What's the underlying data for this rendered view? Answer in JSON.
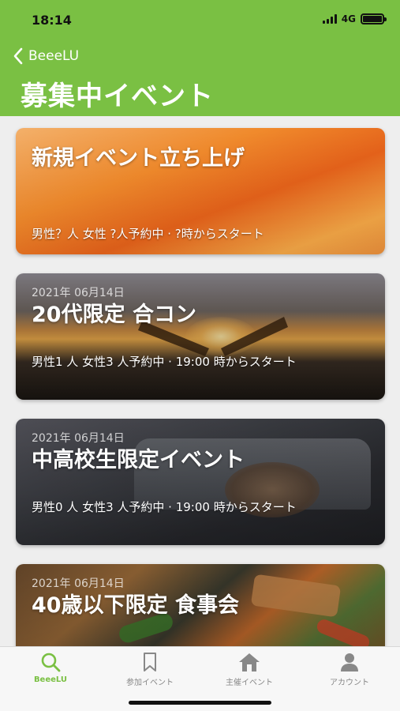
{
  "status_bar": {
    "time": "18:14",
    "network": "4G"
  },
  "nav": {
    "back_label": "BeeeLU",
    "title": "募集中イベント"
  },
  "events": [
    {
      "date": "",
      "title": "新規イベント立ち上げ",
      "info": "男性？人 女性 ?人予約中 · ?時からスタート"
    },
    {
      "date": "2021年 06月14日",
      "title": "20代限定 合コン",
      "info": "男性1 人 女性3 人予約中 · 19:00 時からスタート"
    },
    {
      "date": "2021年 06月14日",
      "title": "中高校生限定イベント",
      "info": "男性0 人 女性3 人予約中 · 19:00 時からスタート"
    },
    {
      "date": "2021年 06月14日",
      "title": "40歳以下限定 食事会",
      "info": ""
    }
  ],
  "tabs": [
    {
      "label": "BeeeLU",
      "icon": "search-icon",
      "active": true
    },
    {
      "label": "参加イベント",
      "icon": "bookmark-icon",
      "active": false
    },
    {
      "label": "主催イベント",
      "icon": "house-icon",
      "active": false
    },
    {
      "label": "アカウント",
      "icon": "person-icon",
      "active": false
    }
  ],
  "colors": {
    "accent": "#7ac043",
    "tab_inactive": "#888888"
  }
}
